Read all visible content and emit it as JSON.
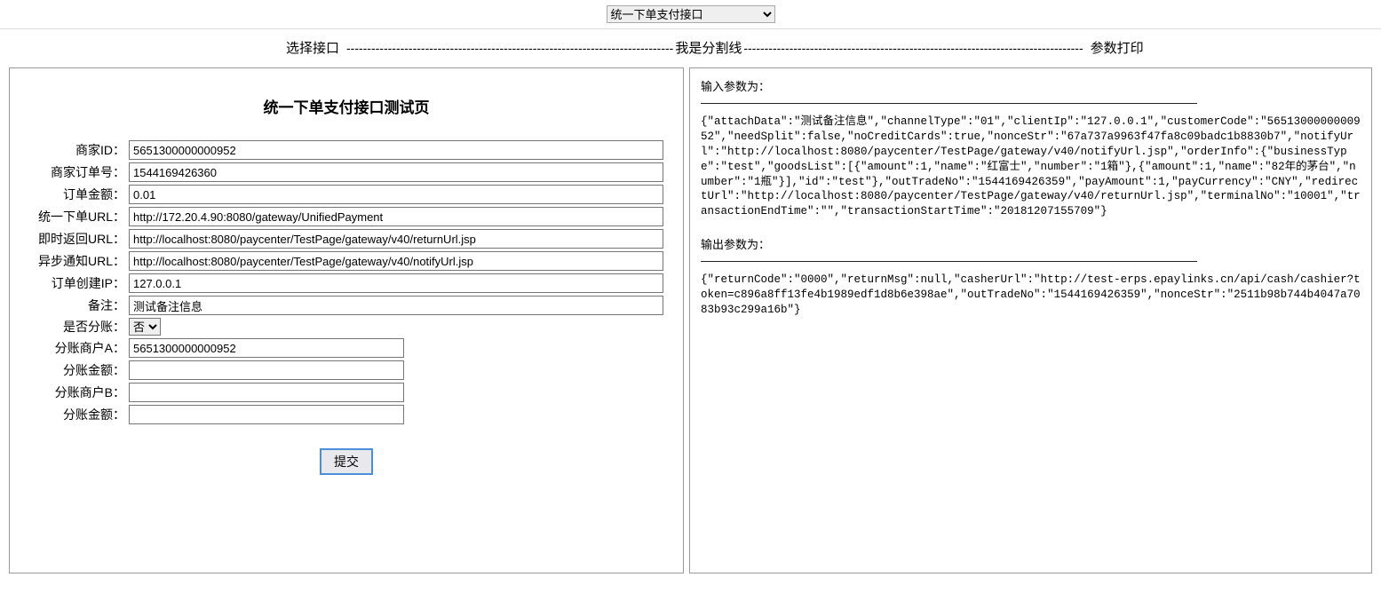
{
  "topSelect": {
    "value": "统一下单支付接口"
  },
  "header": {
    "leftLabel": "选择接口",
    "midLabel": "我是分割线",
    "rightLabel": "参数打印"
  },
  "form": {
    "title": "统一下单支付接口测试页",
    "labels": {
      "merchantId": "商家ID：",
      "orderNo": "商家订单号：",
      "amount": "订单金额：",
      "unifiedUrl": "统一下单URL：",
      "returnUrl": "即时返回URL：",
      "notifyUrl": "异步通知URL：",
      "clientIp": "订单创建IP：",
      "remark": "备注：",
      "needSplit": "是否分账：",
      "splitMerchantA": "分账商户A：",
      "splitAmountA": "分账金额：",
      "splitMerchantB": "分账商户B：",
      "splitAmountB": "分账金额："
    },
    "values": {
      "merchantId": "5651300000000952",
      "orderNo": "1544169426360",
      "amount": "0.01",
      "unifiedUrl": "http://172.20.4.90:8080/gateway/UnifiedPayment",
      "returnUrl": "http://localhost:8080/paycenter/TestPage/gateway/v40/returnUrl.jsp",
      "notifyUrl": "http://localhost:8080/paycenter/TestPage/gateway/v40/notifyUrl.jsp",
      "clientIp": "127.0.0.1",
      "remark": "测试备注信息",
      "needSplit": "否",
      "splitMerchantA": "5651300000000952",
      "splitAmountA": "",
      "splitMerchantB": "",
      "splitAmountB": ""
    },
    "submit": "提交"
  },
  "output": {
    "inputTitle": "输入参数为：",
    "inputBody": "{\"attachData\":\"测试备注信息\",\"channelType\":\"01\",\"clientIp\":\"127.0.0.1\",\"customerCode\":\"5651300000000952\",\"needSplit\":false,\"noCreditCards\":true,\"nonceStr\":\"67a737a9963f47fa8c09badc1b8830b7\",\"notifyUrl\":\"http://localhost:8080/paycenter/TestPage/gateway/v40/notifyUrl.jsp\",\"orderInfo\":{\"businessType\":\"test\",\"goodsList\":[{\"amount\":1,\"name\":\"红富士\",\"number\":\"1箱\"},{\"amount\":1,\"name\":\"82年的茅台\",\"number\":\"1瓶\"}],\"id\":\"test\"},\"outTradeNo\":\"1544169426359\",\"payAmount\":1,\"payCurrency\":\"CNY\",\"redirectUrl\":\"http://localhost:8080/paycenter/TestPage/gateway/v40/returnUrl.jsp\",\"terminalNo\":\"10001\",\"transactionEndTime\":\"\",\"transactionStartTime\":\"20181207155709\"}",
    "outputTitle": "输出参数为：",
    "outputBody": "{\"returnCode\":\"0000\",\"returnMsg\":null,\"casherUrl\":\"http://test-erps.epaylinks.cn/api/cash/cashier?token=c896a8ff13fe4b1989edf1d8b6e398ae\",\"outTradeNo\":\"1544169426359\",\"nonceStr\":\"2511b98b744b4047a7083b93c299a16b\"}"
  }
}
